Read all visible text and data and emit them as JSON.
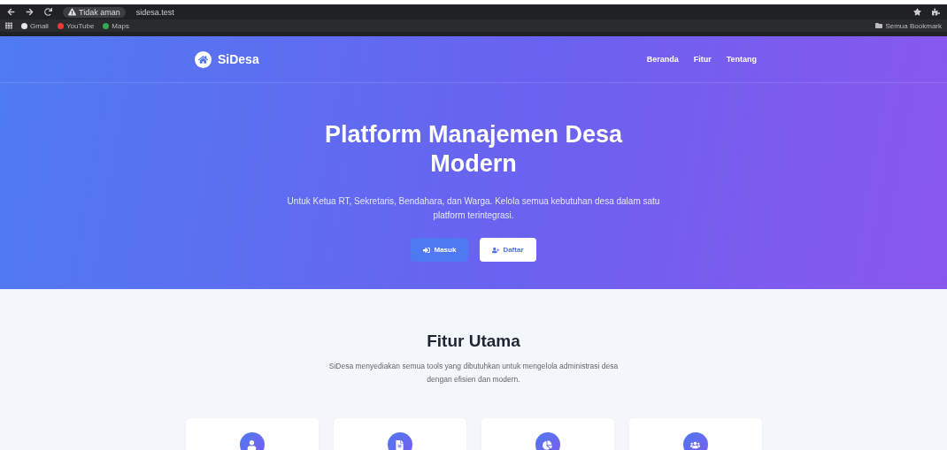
{
  "browser": {
    "security": "Tidak aman",
    "url": "sidesa.test",
    "bookmarks": [
      {
        "label": "Gmail",
        "color": "#e8e8e8"
      },
      {
        "label": "YouTube",
        "color": "#e53935"
      },
      {
        "label": "Maps",
        "color": "#34a853"
      }
    ],
    "all_bookmarks": "Semua Bookmark"
  },
  "nav": {
    "brand": "SiDesa",
    "links": [
      "Beranda",
      "Fitur",
      "Tentang"
    ]
  },
  "hero": {
    "title": "Platform Manajemen Desa Modern",
    "subtitle": "Untuk Ketua RT, Sekretaris, Bendahara, dan Warga. Kelola semua kebutuhan desa dalam satu platform terintegrasi.",
    "buttons": [
      {
        "label": "Masuk",
        "kind": "login"
      },
      {
        "label": "Daftar",
        "kind": "register"
      }
    ]
  },
  "features": {
    "title": "Fitur Utama",
    "subtitle": "SiDesa menyediakan semua tools yang dibutuhkan untuk mengelola administrasi desa dengan efisien dan modern.",
    "cards": [
      {
        "kind": "user"
      },
      {
        "kind": "document"
      },
      {
        "kind": "chart"
      },
      {
        "kind": "users"
      }
    ]
  }
}
